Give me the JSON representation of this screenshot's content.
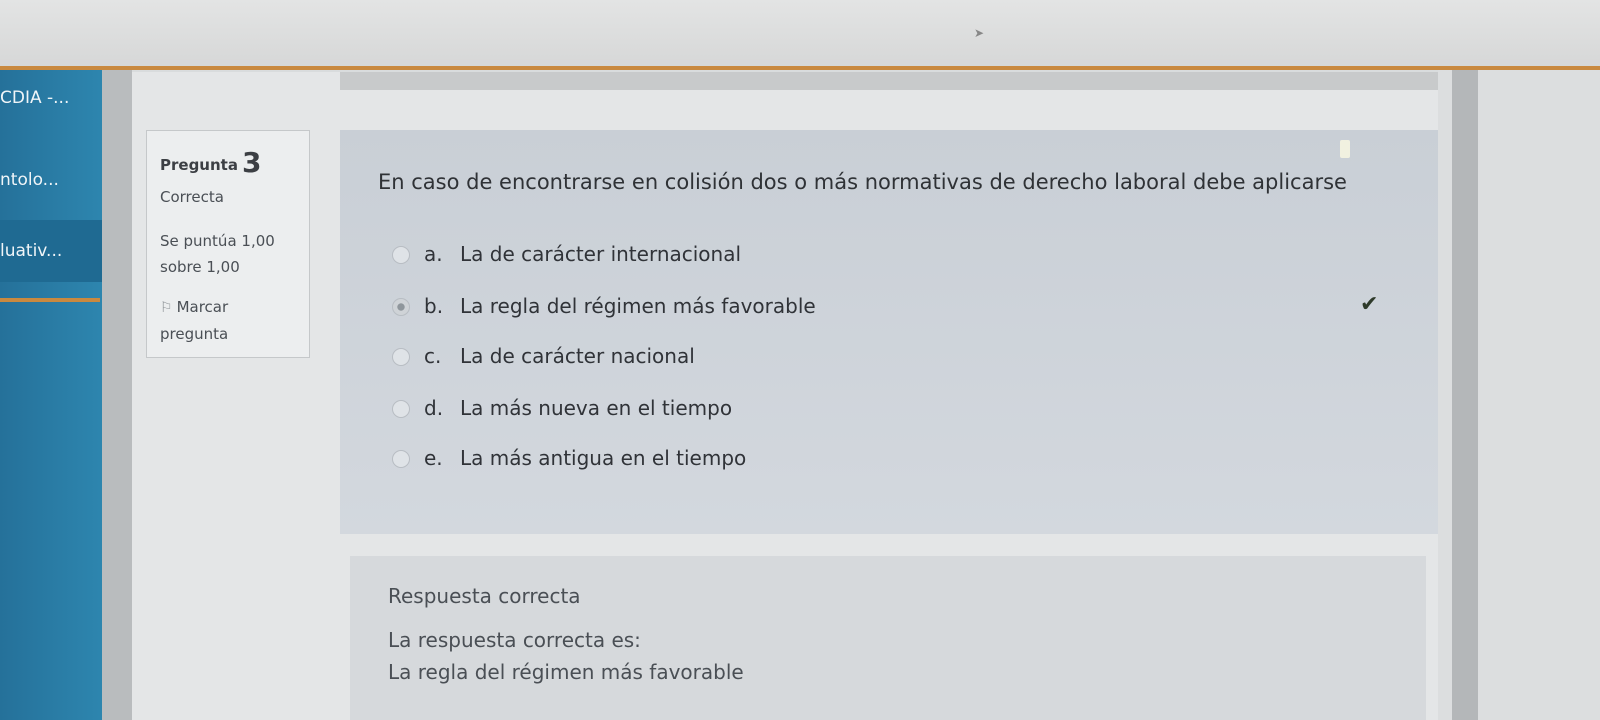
{
  "sidebar": {
    "items": [
      {
        "label": "CDIA -..."
      },
      {
        "label": "ntolo..."
      },
      {
        "label": "luativ..."
      }
    ]
  },
  "question": {
    "heading": "Pregunta",
    "number": "3",
    "status": "Correcta",
    "score": "Se puntúa 1,00 sobre 1,00",
    "flag_label": "Marcar pregunta",
    "text": "En caso de encontrarse en colisión dos o más normativas de derecho laboral debe aplicarse",
    "options": [
      {
        "letter": "a.",
        "label": "La de carácter internacional",
        "selected": false
      },
      {
        "letter": "b.",
        "label": "La regla del régimen más favorable",
        "selected": true
      },
      {
        "letter": "c.",
        "label": "La de carácter nacional",
        "selected": false
      },
      {
        "letter": "d.",
        "label": "La más nueva en el tiempo",
        "selected": false
      },
      {
        "letter": "e.",
        "label": "La más antigua en el tiempo",
        "selected": false
      }
    ]
  },
  "feedback": {
    "result": "Respuesta correcta",
    "correct_prefix": "La respuesta correcta es:",
    "correct_answer": "La regla del régimen más favorable"
  },
  "icons": {
    "flag": "flag-icon",
    "check": "check-icon"
  }
}
